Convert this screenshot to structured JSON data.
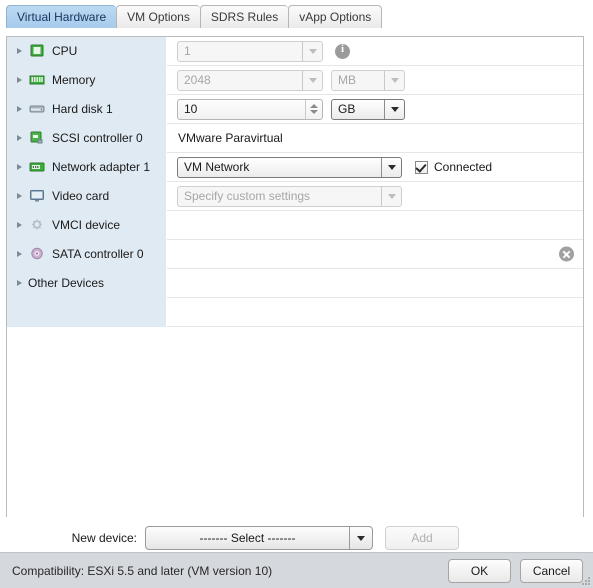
{
  "tabs": [
    {
      "label": "Virtual Hardware",
      "active": true
    },
    {
      "label": "VM Options",
      "active": false
    },
    {
      "label": "SDRS Rules",
      "active": false
    },
    {
      "label": "vApp Options",
      "active": false
    }
  ],
  "devices": {
    "cpu": {
      "label": "CPU",
      "icon": "cpu-icon",
      "value": "1"
    },
    "memory": {
      "label": "Memory",
      "icon": "memory-icon",
      "value": "2048",
      "unit": "MB"
    },
    "harddisk": {
      "label": "Hard disk 1",
      "icon": "hard-disk-icon",
      "value": "10",
      "unit": "GB"
    },
    "scsi": {
      "label": "SCSI controller 0",
      "icon": "scsi-controller-icon",
      "value": "VMware Paravirtual"
    },
    "network": {
      "label": "Network adapter 1",
      "icon": "network-adapter-icon",
      "value": "VM Network",
      "connected_label": "Connected",
      "connected": true
    },
    "video": {
      "label": "Video card",
      "icon": "video-card-icon",
      "value": "Specify custom settings"
    },
    "vmci": {
      "label": "VMCI device",
      "icon": "vmci-device-icon"
    },
    "sata": {
      "label": "SATA controller 0",
      "icon": "sata-controller-icon"
    },
    "other": {
      "label": "Other Devices",
      "icon": "none"
    }
  },
  "new_device": {
    "label": "New device:",
    "selected": "------- Select -------",
    "add_label": "Add"
  },
  "footer": {
    "compatibility": "Compatibility: ESXi 5.5 and later (VM version 10)",
    "ok_label": "OK",
    "cancel_label": "Cancel"
  },
  "colors": {
    "tab_active": "#a6cbec",
    "label_column": "#e0eaf2",
    "footer_bar": "#d5d9dd",
    "panel_border": "#b9bcbf"
  }
}
